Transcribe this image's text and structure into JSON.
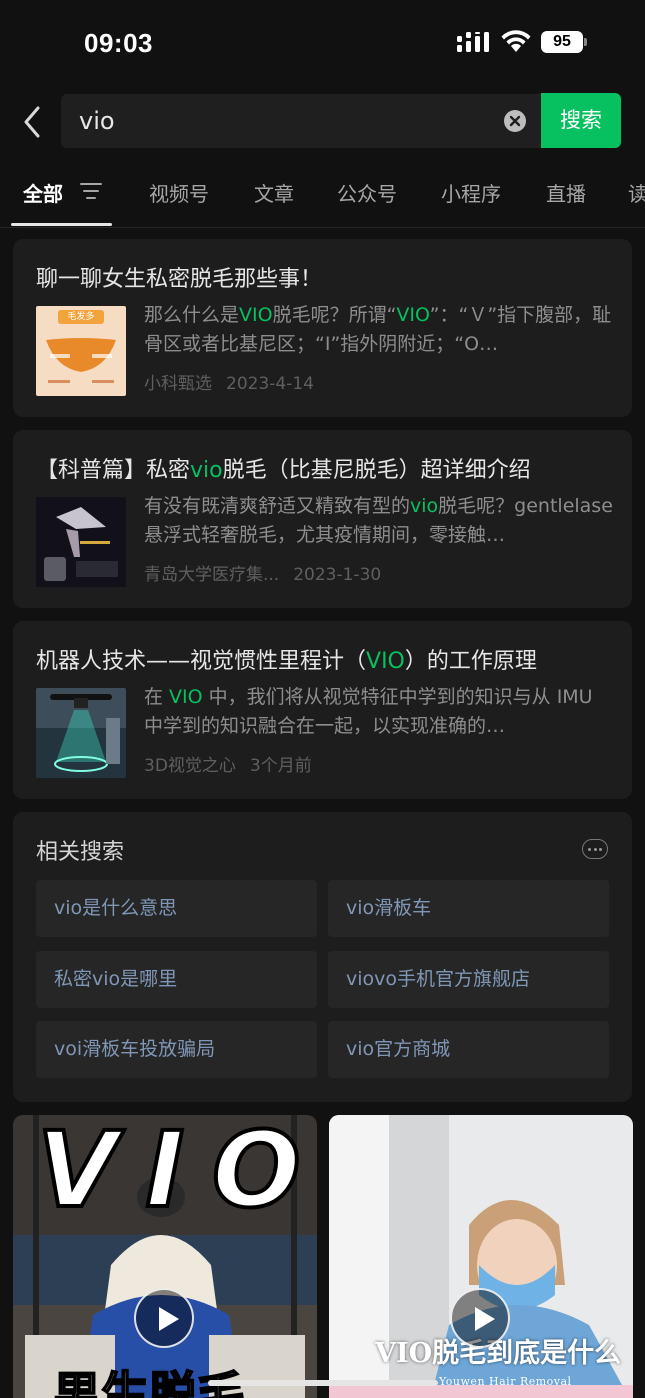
{
  "status_bar": {
    "time": "09:03",
    "battery": "95"
  },
  "search": {
    "query": "vio",
    "button_label": "搜索"
  },
  "tabs": [
    {
      "label": "全部"
    },
    {
      "label": "视频号"
    },
    {
      "label": "文章"
    },
    {
      "label": "公众号"
    },
    {
      "label": "小程序"
    },
    {
      "label": "直播"
    },
    {
      "label": "读"
    }
  ],
  "results": [
    {
      "title": "聊一聊女生私密脱毛那些事！",
      "snippet_parts": [
        "那么什么是",
        "VIO",
        "脱毛呢？所谓“",
        "VIO",
        "”：“Ｖ”指下腹部，耻骨区或者比基尼区；“I”指外阴附近；“O…"
      ],
      "source": "小科甄选",
      "date": "2023-4-14",
      "thumb_text": "毛发多"
    },
    {
      "title_parts": [
        "【科普篇】私密",
        "vio",
        "脱毛（比基尼脱毛）超详细介绍"
      ],
      "snippet_parts": [
        "有没有既清爽舒适又精致有型的",
        "vio",
        "脱毛呢？gentlelase悬浮式轻奢脱毛，尤其疫情期间，零接触…"
      ],
      "source": "青岛大学医疗集...",
      "date": "2023-1-30"
    },
    {
      "title_parts": [
        "机器人技术——视觉惯性里程计（",
        "VIO",
        "）的工作原理"
      ],
      "snippet_parts": [
        "在 ",
        "VIO",
        " 中，我们将从视觉特征中学到的知识与从 IMU 中学到的知识融合在一起，以实现准确的…"
      ],
      "source": "3D视觉之心",
      "date": "3个月前"
    }
  ],
  "related": {
    "title": "相关搜索",
    "items": [
      "vio是什么意思",
      "vio滑板车",
      "私密vio是哪里",
      "viovo手机官方旗舰店",
      "voi滑板车投放骗局",
      "vio官方商城"
    ]
  },
  "videos": [
    {
      "overlay_title": "VIO",
      "caption": "男生脱毛"
    },
    {
      "caption": "VIO脱毛到底是什么",
      "subcaption": "Youwen Hair Removal"
    }
  ],
  "colors": {
    "accent": "#07c160",
    "link": "#7f97b6",
    "card_bg": "#1d1d1d",
    "page_bg": "#111111"
  }
}
